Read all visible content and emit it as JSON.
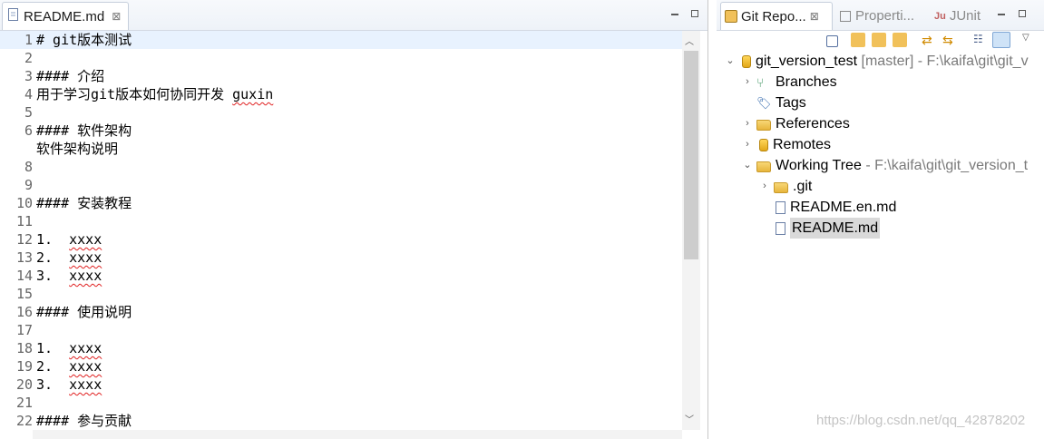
{
  "editor": {
    "tab_title": "README.md",
    "tab_close": "⊠",
    "lines": [
      {
        "n": "1",
        "text": "# git版本测试"
      },
      {
        "n": "2",
        "text": ""
      },
      {
        "n": "3",
        "text": "#### 介绍"
      },
      {
        "n": "4",
        "text": "用于学习git版本如何协同开发 guxin"
      },
      {
        "n": "5",
        "text": ""
      },
      {
        "n": "6",
        "text": "#### 软件架构"
      },
      {
        "n": "",
        "text": "软件架构说明"
      },
      {
        "n": "8",
        "text": ""
      },
      {
        "n": "9",
        "text": ""
      },
      {
        "n": "10",
        "text": "#### 安装教程"
      },
      {
        "n": "11",
        "text": ""
      },
      {
        "n": "12",
        "text": "1.  xxxx"
      },
      {
        "n": "13",
        "text": "2.  xxxx"
      },
      {
        "n": "14",
        "text": "3.  xxxx"
      },
      {
        "n": "15",
        "text": ""
      },
      {
        "n": "16",
        "text": "#### 使用说明"
      },
      {
        "n": "17",
        "text": ""
      },
      {
        "n": "18",
        "text": "1.  xxxx"
      },
      {
        "n": "19",
        "text": "2.  xxxx"
      },
      {
        "n": "20",
        "text": "3.  xxxx"
      },
      {
        "n": "21",
        "text": ""
      },
      {
        "n": "22",
        "text": "#### 参与贡献"
      }
    ]
  },
  "git_view": {
    "tabs": [
      {
        "label": "Git Repo..."
      },
      {
        "label": "Properti..."
      },
      {
        "label": "JUnit"
      }
    ],
    "repo": {
      "name": "git_version_test",
      "detail": "[master] - F:\\kaifa\\git\\git_v"
    },
    "nodes": {
      "branches": "Branches",
      "tags": "Tags",
      "references": "References",
      "remotes": "Remotes",
      "working_tree": "Working Tree",
      "working_tree_path": "- F:\\kaifa\\git\\git_version_t",
      "git_folder": ".git",
      "readme_en": "README.en.md",
      "readme": "README.md"
    }
  },
  "watermark": "https://blog.csdn.net/qq_42878202"
}
